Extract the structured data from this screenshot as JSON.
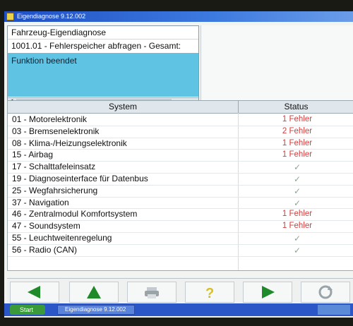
{
  "window": {
    "title": "Eigendiagnose 9.12.002"
  },
  "info": {
    "line1": "Fahrzeug-Eigendiagnose",
    "line2": "1001.01 - Fehlerspeicher abfragen - Gesamt:",
    "line3": "Funktion beendet"
  },
  "table": {
    "headers": {
      "system": "System",
      "status": "Status"
    },
    "rows": [
      {
        "system": "01 - Motorelektronik",
        "status": "1 Fehler"
      },
      {
        "system": "03 - Bremsenelektronik",
        "status": "2 Fehler"
      },
      {
        "system": "08 - Klima-/Heizungselektronik",
        "status": "1 Fehler"
      },
      {
        "system": "15 - Airbag",
        "status": "1 Fehler"
      },
      {
        "system": "17 - Schalttafeleinsatz",
        "status": "✓"
      },
      {
        "system": "19 - Diagnoseinterface für  Datenbus",
        "status": "✓"
      },
      {
        "system": "25 - Wegfahrsicherung",
        "status": "✓"
      },
      {
        "system": "37 - Navigation",
        "status": "✓"
      },
      {
        "system": "46 - Zentralmodul Komfortsystem",
        "status": "1 Fehler"
      },
      {
        "system": "47 - Soundsystem",
        "status": "1 Fehler"
      },
      {
        "system": "55 - Leuchtweitenregelung",
        "status": "✓"
      },
      {
        "system": "56 - Radio (CAN)",
        "status": "✓"
      }
    ]
  },
  "toolbar": {
    "buttons": [
      {
        "icon": "arrow-left-icon",
        "color": "#1e8a2a"
      },
      {
        "icon": "arrow-up-icon",
        "color": "#1e8a2a"
      },
      {
        "icon": "printer-icon",
        "color": "#9aa3a8"
      },
      {
        "icon": "help-icon",
        "color": "#d8c020"
      },
      {
        "icon": "arrow-right-icon",
        "color": "#1e8a2a"
      },
      {
        "icon": "refresh-icon",
        "color": "#9aa3a8"
      }
    ]
  },
  "taskbar": {
    "start_label": "Start",
    "task_label": "Eigendiagnose 9.12.002"
  },
  "colors": {
    "error": "#d83a3a",
    "ok": "#8fa394",
    "highlight": "#5fc3e3",
    "titlebar": "#1f4fc4"
  }
}
